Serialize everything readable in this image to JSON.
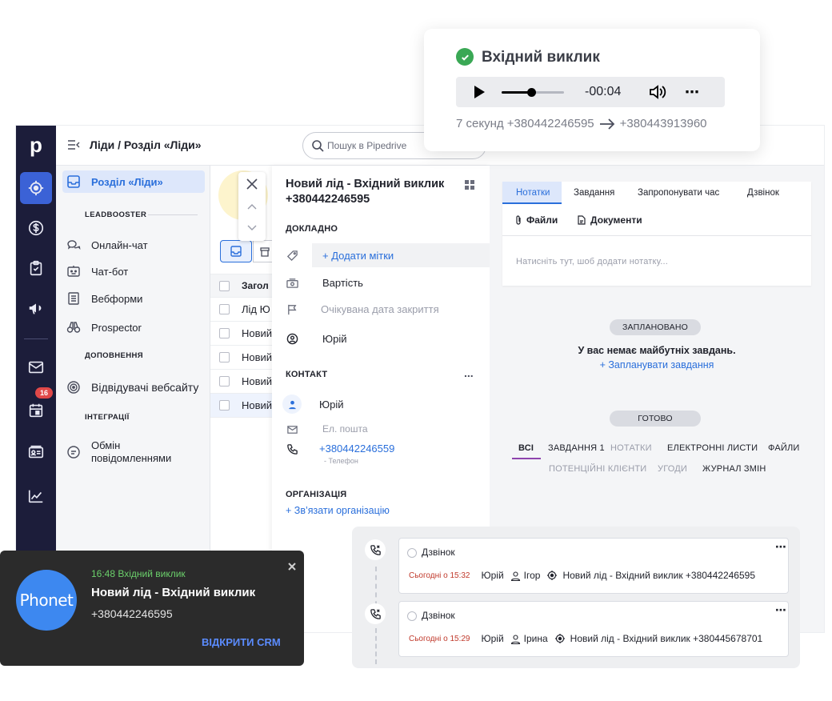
{
  "callPopup": {
    "title": "Вхідний виклик",
    "time": "-00:04",
    "summary": "7 секунд +380442246595",
    "to": "+380443913960",
    "colors": {
      "check": "#3aa855",
      "playerBg": "#ebecef"
    }
  },
  "topbar": {
    "breadcrumb": "Ліди / Розділ «Ліди»",
    "searchPlaceholder": "Пошук в Pipedrive"
  },
  "rail": {
    "logo": "p",
    "badge": "16",
    "icons": [
      "target-icon",
      "dollar-icon",
      "clipboard-icon",
      "megaphone-icon",
      "mail-icon",
      "calendar-icon",
      "contacts-card-icon",
      "trending-icon"
    ]
  },
  "leftnav": {
    "active": "Розділ «Ліди»",
    "sections": {
      "leadbooster": "LEADBOOSTER",
      "addons": "ДОПОВНЕННЯ",
      "integrations": "ІНТЕГРАЦІЇ"
    },
    "items": {
      "chat": "Онлайн-чат",
      "bot": "Чат-бот",
      "forms": "Вебформи",
      "prospector": "Prospector",
      "visitors": "Відвідувачі вебсайту",
      "messages": "Обмін повідомленнями"
    }
  },
  "list": {
    "header": "Загол",
    "rows": [
      "Лід Ю",
      "Новий",
      "Новий",
      "Новий",
      "Новий"
    ]
  },
  "detail": {
    "title": "Новий лід - Вхідний виклик +380442246595",
    "sections": {
      "details": "ДОКЛАДНО",
      "contact": "КОНТАКТ",
      "org": "ОРГАНІЗАЦІЯ"
    },
    "addLabels": "+ Додати мітки",
    "value": "Вартість",
    "closeDate": "Очікувана дата закриття",
    "owner": "Юрій",
    "contactName": "Юрій",
    "email": "Ел. пошта",
    "phone": "+380442246559",
    "phoneType": "Телефон",
    "linkOrg": "+ Зв’язати організацію",
    "more": "..."
  },
  "right": {
    "tabs": [
      "Нотатки",
      "Завдання",
      "Запропонувати час",
      "Дзвінок"
    ],
    "subtabs": [
      "Файли",
      "Документи"
    ],
    "notePlaceholder": "Натисніть тут, шоб додати нотатку...",
    "planned": "ЗАПЛАНОВАНО",
    "noTasks": "У вас немає майбутніх завдань.",
    "planTask": "+ Запланувати завдання",
    "done": "ГОТОВО",
    "filters1": [
      "ВСІ",
      "ЗАВДАННЯ 1",
      "НОТАТКИ",
      "ЕЛЕКТРОННІ ЛИСТИ",
      "ФАЙЛИ"
    ],
    "filters2": [
      "ПОТЕНЦІЙНІ КЛІЄНТИ",
      "УГОДИ",
      "ЖУРНАЛ ЗМІН"
    ],
    "accent": "#2a6fdb"
  },
  "phonet": {
    "logo": "Phonet",
    "status": "16:48 Вхідний виклик",
    "title": "Новий лід - Вхідний виклик",
    "number": "+380442246595",
    "open": "ВІДКРИТИ CRM",
    "colors": {
      "bg": "#2b2b2b",
      "status": "#6bd06b",
      "link": "#5b8cff",
      "logoBg": "#3d88f0"
    }
  },
  "activities": [
    {
      "type": "Дзвінок",
      "when": "Сьогодні о 15:32",
      "owner": "Юрій",
      "person": "Ігор",
      "lead": "Новий лід - Вхідний виклик +380442246595"
    },
    {
      "type": "Дзвінок",
      "when": "Сьогодні о 15:29",
      "owner": "Юрій",
      "person": "Ірина",
      "lead": "Новий лід - Вхідний виклик +380445678701"
    }
  ]
}
